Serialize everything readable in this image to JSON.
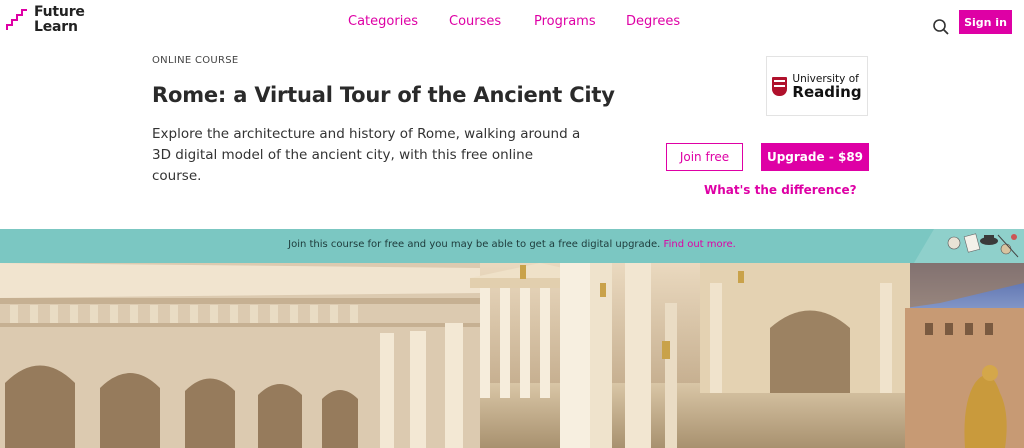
{
  "brand": {
    "line1": "Future",
    "line2": "Learn"
  },
  "nav": {
    "items": [
      {
        "label": "Categories"
      },
      {
        "label": "Courses"
      },
      {
        "label": "Programs"
      },
      {
        "label": "Degrees"
      }
    ],
    "search_icon": "search-icon",
    "signin_label": "Sign in"
  },
  "course": {
    "kicker": "ONLINE COURSE",
    "title": "Rome: a Virtual Tour of the Ancient City",
    "description": "Explore the architecture and history of Rome, walking around a 3D digital model of the ancient city, with this free online course."
  },
  "university": {
    "line1": "University of",
    "line2": "Reading"
  },
  "actions": {
    "join_label": "Join free",
    "upgrade_label": "Upgrade - $89",
    "difference_label": "What's the difference?"
  },
  "banner": {
    "text": "Join this course for free and you may be able to get a free digital upgrade.",
    "link": "Find out more."
  },
  "colors": {
    "accent": "#de00a5",
    "banner": "#7bc7c2"
  }
}
